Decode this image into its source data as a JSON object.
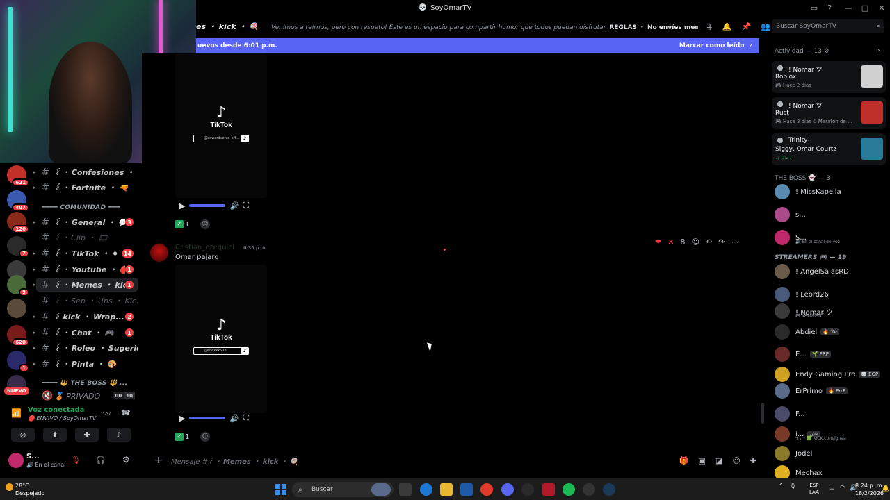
{
  "window": {
    "title": "SoyOmarTV",
    "controls": [
      "—",
      "□",
      "✕"
    ]
  },
  "colors": {
    "accent": "#5865f2",
    "mention_red": "#f23f43",
    "online_green": "#23a55a"
  },
  "servers": [
    {
      "badge": "621",
      "color": "#c2302a"
    },
    {
      "badge": "407",
      "color": "#3a5ab0"
    },
    {
      "badge": "120",
      "color": "#8a2a1a"
    },
    {
      "badge": "7",
      "color": "#2a2a2a"
    },
    {
      "badge": "",
      "color": "#3a3a3a"
    },
    {
      "badge": "9",
      "color": "#4a6a3a"
    },
    {
      "badge": "",
      "color": "#5a4a3a"
    },
    {
      "badge": "620",
      "color": "#7a1a1a"
    },
    {
      "badge": "1",
      "color": "#2a2a6a"
    },
    {
      "badge": "",
      "color": "#3a2a4a"
    }
  ],
  "nuevo_label": "NUEVO",
  "channels": [
    {
      "name": "꒰ ・ Confesiones ・ 🤫",
      "count": "",
      "muted": false,
      "active": false
    },
    {
      "name": "꒰ ・ Fortnite ・ 🔫",
      "count": "",
      "muted": false,
      "active": false
    },
    {
      "name": "꒰ ・ General ・ 💬",
      "count": "3",
      "muted": false,
      "active": false
    },
    {
      "name": "꒰ ・ Clip ・ 🎞",
      "count": "",
      "muted": true,
      "active": false
    },
    {
      "name": "꒰ ・ TikTok ・ ⚫",
      "count": "14",
      "muted": false,
      "active": false
    },
    {
      "name": "꒰ ・ Youtube ・ 🔴",
      "count": "1",
      "muted": false,
      "active": false
    },
    {
      "name": "꒰ ・ Memes ・ kic...",
      "count": "1",
      "muted": false,
      "active": true
    },
    {
      "name": "꒰ ・ Sep ・ Ups ・ Kic...",
      "count": "",
      "muted": true,
      "active": false
    },
    {
      "name": "꒰ kick ・ Wrap...",
      "count": "2",
      "muted": false,
      "active": false
    },
    {
      "name": "꒰ ・ Chat ・ 🎮",
      "count": "1",
      "muted": false,
      "active": false
    },
    {
      "name": "꒰ ・ Roleo ・ Sugerido...",
      "count": "",
      "muted": false,
      "active": false
    },
    {
      "name": "꒰ ・ Pinta ・ 🎨",
      "count": "",
      "muted": false,
      "active": false
    }
  ],
  "categories": {
    "comunidad": "━━━━ COMUNIDAD ━━━",
    "boss": "━━━━ 🔱 THE BOSS 🔱 ..."
  },
  "voice_channel": {
    "name": "🥉 PRIVADO",
    "count_a": "00",
    "count_b": "10"
  },
  "voice": {
    "status": "Voz conectada",
    "channel": "🔴 ENVIVO / SoyOmarTV"
  },
  "user": {
    "name": "S...",
    "status": "🔊 En el canal"
  },
  "header": {
    "channel": "es ・ kick ・ 🍭",
    "topic_lead": "Venimos a reírnos, pero con respeto! Este es un espacio para compartir humor que todos puedan disfrutar.",
    "topic_rules": "REGLAS",
    "topic_tail": "・ No envíes memes que contengan m...",
    "search_placeholder": "Buscar SoyOmarTV"
  },
  "new_messages": {
    "text": "uevos desde 6:01 p.m.",
    "action": "Marcar como leído"
  },
  "messages": [
    {
      "tiktok_word": "TikTok",
      "tiktok_handle": "@edwardveras_off...",
      "reaction_count": "1"
    },
    {
      "author": "Cristian_ezequiel",
      "time": "6:35 p.m.",
      "content": "Omar pajaro",
      "tiktok_word": "TikTok",
      "tiktok_handle": "@enexxx503",
      "reaction_count": "1",
      "super_count": "8"
    }
  ],
  "composer": {
    "placeholder_pre": "Mensaje #꒰ ・",
    "placeholder_chan": "Memes ・ kick",
    "placeholder_post": "・ 🍭"
  },
  "activity": {
    "header": "Actividad — 13",
    "cards": [
      {
        "who": "! Nomar ツ",
        "game": "Roblox",
        "sub": "🎮 Hace 2 días",
        "green": false,
        "color": "#d0d0d0"
      },
      {
        "who": "! Nomar ツ",
        "game": "Rust",
        "sub": "🎮 Hace 3 días  ⏱ Maratón de ...",
        "green": false,
        "color": "#c0302a"
      },
      {
        "who": "Trinity-",
        "game": "Siggy, Omar Courtz",
        "sub": "♫ 0:27",
        "green": true,
        "color": "#2a7a9a"
      }
    ]
  },
  "groups": {
    "boss": "THE BOSS 👻 — 3",
    "streamers": "STREAMERS 🎮 — 19"
  },
  "members_boss": [
    {
      "name": "! MissKapella",
      "sub": "",
      "tag": "",
      "color": "#5a8ab0"
    },
    {
      "name": "s...",
      "sub": "",
      "tag": "",
      "color": "#aa4a8a"
    },
    {
      "name": "S...",
      "sub": "🔊 En el canal de voz",
      "tag": "",
      "color": "#c02a6a"
    }
  ],
  "members_streamers": [
    {
      "name": "! AngelSalasRD",
      "sub": "",
      "tag": "",
      "color": "#6a5a4a"
    },
    {
      "name": "! Leord26",
      "sub": "",
      "tag": "",
      "color": "#4a5a7a"
    },
    {
      "name": "! Nomar ツ",
      "sub": "🎮 VALORANT",
      "tag": "",
      "color": "#3a3a3a"
    },
    {
      "name": "Abdiel",
      "sub": "",
      "tag": "🔥 ℛℯ",
      "color": "#2a2a2a"
    },
    {
      "name": "E...",
      "sub": "",
      "tag": "🌱 FRP",
      "color": "#6a2a2a"
    },
    {
      "name": "Endy Gaming Pro",
      "sub": "",
      "tag": "💀 EGP",
      "color": "#d0a020"
    },
    {
      "name": "ErPrimo",
      "sub": "",
      "tag": "🔥 ErrP",
      "color": "#5a6a8a"
    },
    {
      "name": "F...",
      "sub": "",
      "tag": "",
      "color": "#4a4a6a"
    },
    {
      "name": "i...",
      "sub": "+1 • 🟩 KICK.com/ignaa",
      "tag": "مش",
      "color": "#7a3a2a"
    },
    {
      "name": "Jodel",
      "sub": "",
      "tag": "",
      "color": "#8a7a2a"
    },
    {
      "name": "Mechax",
      "sub": "",
      "tag": "",
      "color": "#e0b020"
    }
  ],
  "taskbar": {
    "temp": "28°C",
    "weather": "Despejado",
    "search": "Buscar",
    "lang_a": "ESP",
    "lang_b": "LAA",
    "time": "8:24 p. m.",
    "date": "18/2/2026"
  }
}
